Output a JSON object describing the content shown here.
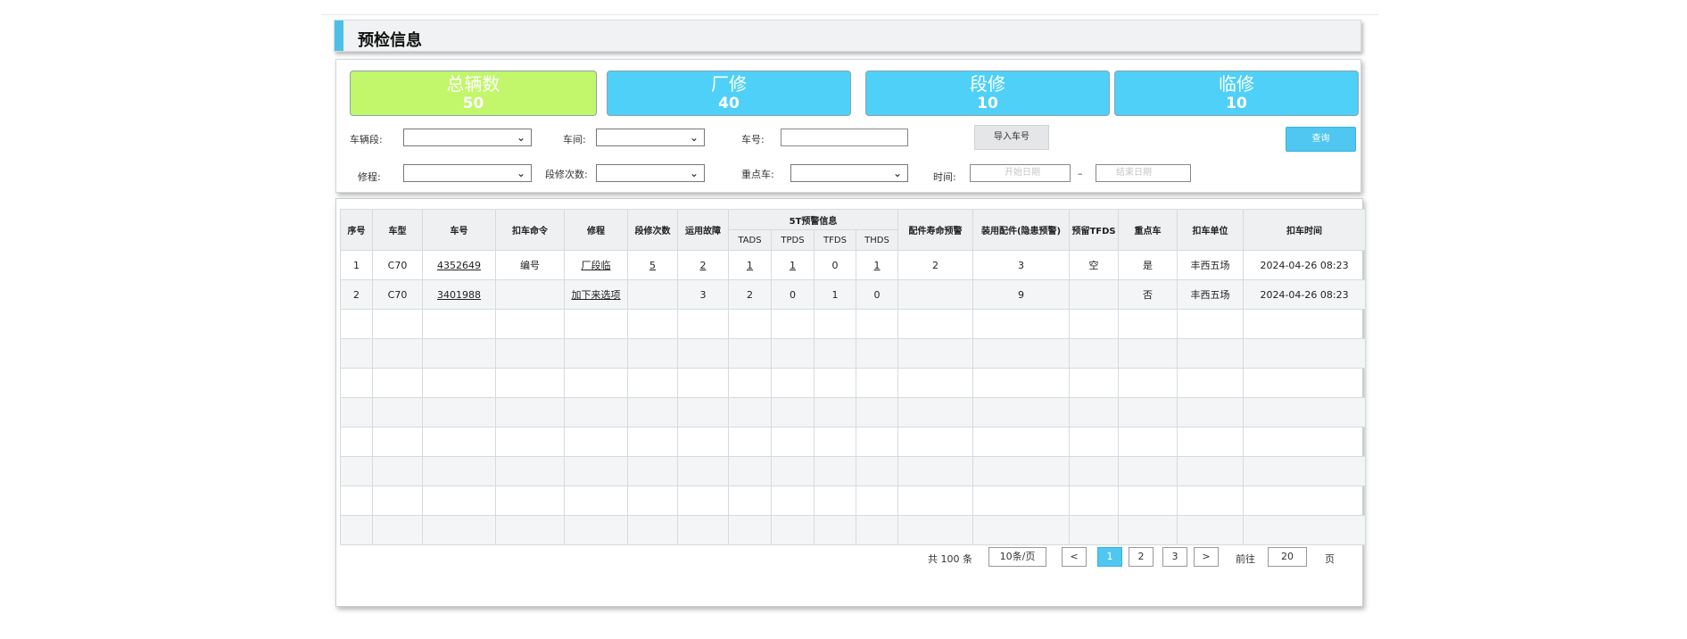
{
  "header": {
    "title": "预检信息"
  },
  "summary": [
    {
      "title": "总辆数",
      "value": "50",
      "color": "#c2f66b"
    },
    {
      "title": "厂修",
      "value": "40",
      "color": "#4fd0f8"
    },
    {
      "title": "段修",
      "value": "10",
      "color": "#4fd0f8"
    },
    {
      "title": "临修",
      "value": "10",
      "color": "#4fd0f8"
    }
  ],
  "filters": {
    "depot_label": "车辆段:",
    "workshop_label": "车间:",
    "car_no_label": "车号:",
    "import_label": "导入车号",
    "query_label": "查询",
    "repair_label": "修程:",
    "repair_count_label": "段修次数:",
    "key_car_label": "重点车:",
    "time_label": "时间:",
    "start_placeholder": "开始日期",
    "end_placeholder": "结束日期",
    "range_sep": "–"
  },
  "table": {
    "headers": {
      "seq": "序号",
      "type": "车型",
      "car_no": "车号",
      "detain_cmd": "扣车命令",
      "repair": "修程",
      "repair_count": "段修次数",
      "op_fault": "运用故障",
      "group_5t": "5T预警信息",
      "tads": "TADS",
      "tpds": "TPDS",
      "tfds": "TFDS",
      "thds": "THDS",
      "parts_life": "配件寿命预警",
      "installed_parts": "装用配件(隐患预警)",
      "retained_tfds": "预留TFDS",
      "key_car": "重点车",
      "detain_unit": "扣车单位",
      "detain_time": "扣车时间"
    },
    "rows": [
      {
        "seq": "1",
        "type": "C70",
        "car_no": "4352649",
        "detain_cmd": "编号",
        "repair": "厂段临",
        "repair_count": "5",
        "op_fault": "2",
        "tads": "1",
        "tpds": "1",
        "tfds": "0",
        "thds": "1",
        "parts_life": "2",
        "installed_parts": "3",
        "retained_tfds": "空",
        "key_car": "是",
        "detain_unit": "丰西五场",
        "detain_time": "2024-04-26 08:23"
      },
      {
        "seq": "2",
        "type": "C70",
        "car_no": "3401988",
        "detain_cmd": "",
        "repair": "加下来选项",
        "repair_count": "",
        "op_fault": "3",
        "tads": "2",
        "tpds": "0",
        "tfds": "1",
        "thds": "0",
        "parts_life": "",
        "installed_parts": "9",
        "retained_tfds": "",
        "key_car": "否",
        "detain_unit": "丰西五场",
        "detain_time": "2024-04-26 08:23"
      }
    ]
  },
  "pagination": {
    "total": "共 100 条",
    "page_size": "10条/页",
    "prev": "<",
    "pages": [
      "1",
      "2",
      "3"
    ],
    "next": ">",
    "goto_label": "前往",
    "goto_value": "20",
    "page_suffix": "页"
  }
}
